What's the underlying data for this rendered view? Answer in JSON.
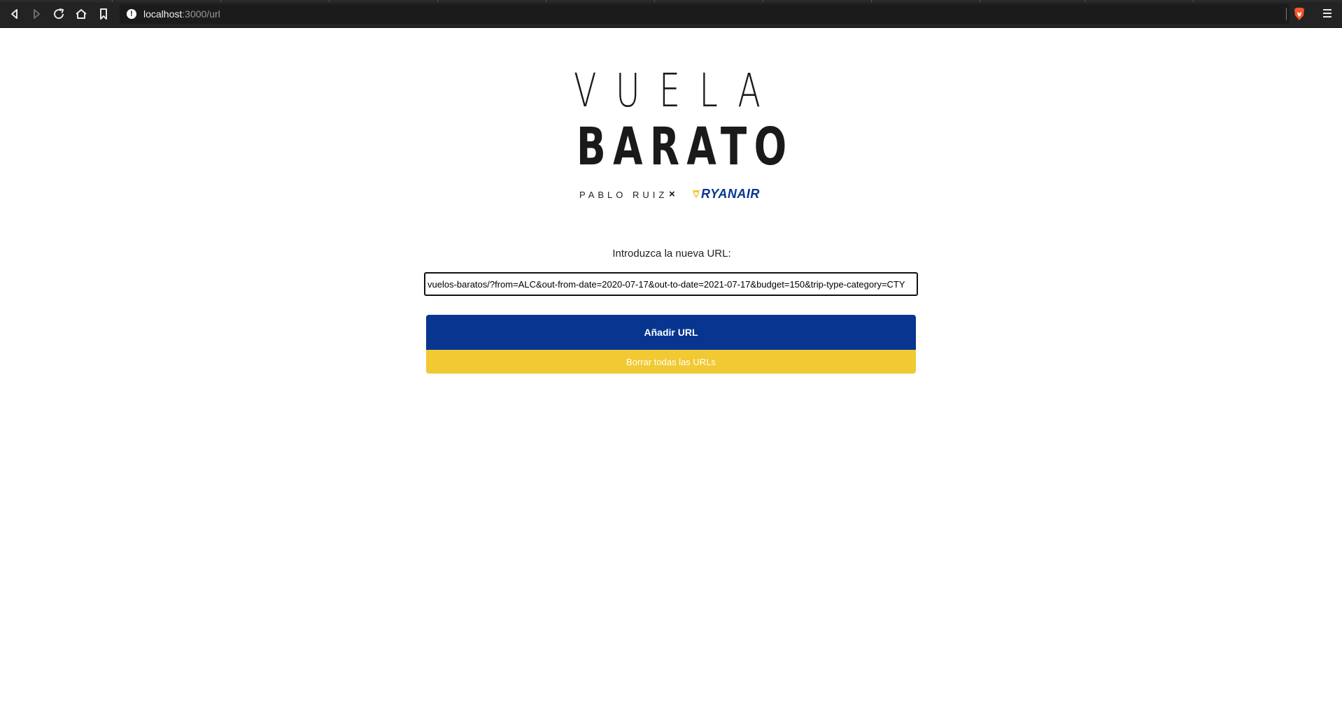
{
  "browser": {
    "url_host": "localhost",
    "url_path": ":3000/url"
  },
  "logo": {
    "line1": "VUELA",
    "line2": "BARATO",
    "author": "PABLO RUIZ",
    "separator": "×",
    "partner": "RYANAIR",
    "partner_color": "#073590"
  },
  "form": {
    "label": "Introduzca la nueva URL:",
    "url_value": "vuelos-baratos/?from=ALC&out-from-date=2020-07-17&out-to-date=2021-07-17&budget=150&trip-type-category=CTY",
    "add_button": "Añadir URL",
    "clear_button": "Borrar todas las URLs"
  },
  "colors": {
    "primary": "#073590",
    "secondary": "#f1c933"
  }
}
